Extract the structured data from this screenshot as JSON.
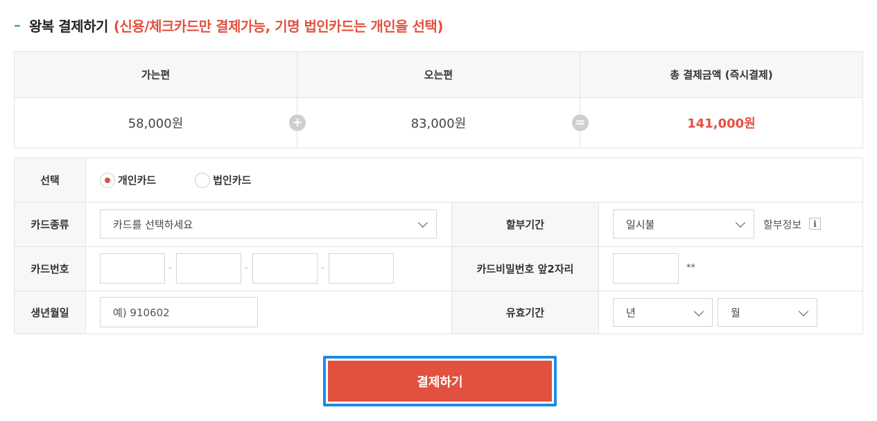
{
  "section": {
    "title": "왕복 결제하기",
    "note": "(신용/체크카드만 결제가능, 기명 법인카드는 개인을 선택)"
  },
  "summary": {
    "headers": [
      "가는편",
      "오는편",
      "총 결제금액 (즉시결제)"
    ],
    "outbound": "58,000원",
    "inbound": "83,000원",
    "total": "141,000원",
    "plus_symbol": "+",
    "equals_symbol": "="
  },
  "form": {
    "select_label": "선택",
    "card_options": [
      {
        "label": "개인카드",
        "selected": true
      },
      {
        "label": "법인카드",
        "selected": false
      }
    ],
    "card_type_label": "카드종류",
    "card_type_placeholder": "카드를 선택하세요",
    "installment_label": "할부기간",
    "installment_value": "일시불",
    "installment_info": "할부정보",
    "info_icon": "i",
    "card_number_label": "카드번호",
    "card_number_separator": "-",
    "password_label": "카드비밀번호 앞2자리",
    "password_suffix": "**",
    "birth_label": "생년월일",
    "birth_placeholder": "예) 910602",
    "expiry_label": "유효기간",
    "expiry_year": "년",
    "expiry_month": "월"
  },
  "actions": {
    "pay_label": "결제하기"
  },
  "colors": {
    "accent": "#e2513f",
    "focus": "#1a8ce8",
    "title_dash": "#3bb39a"
  }
}
